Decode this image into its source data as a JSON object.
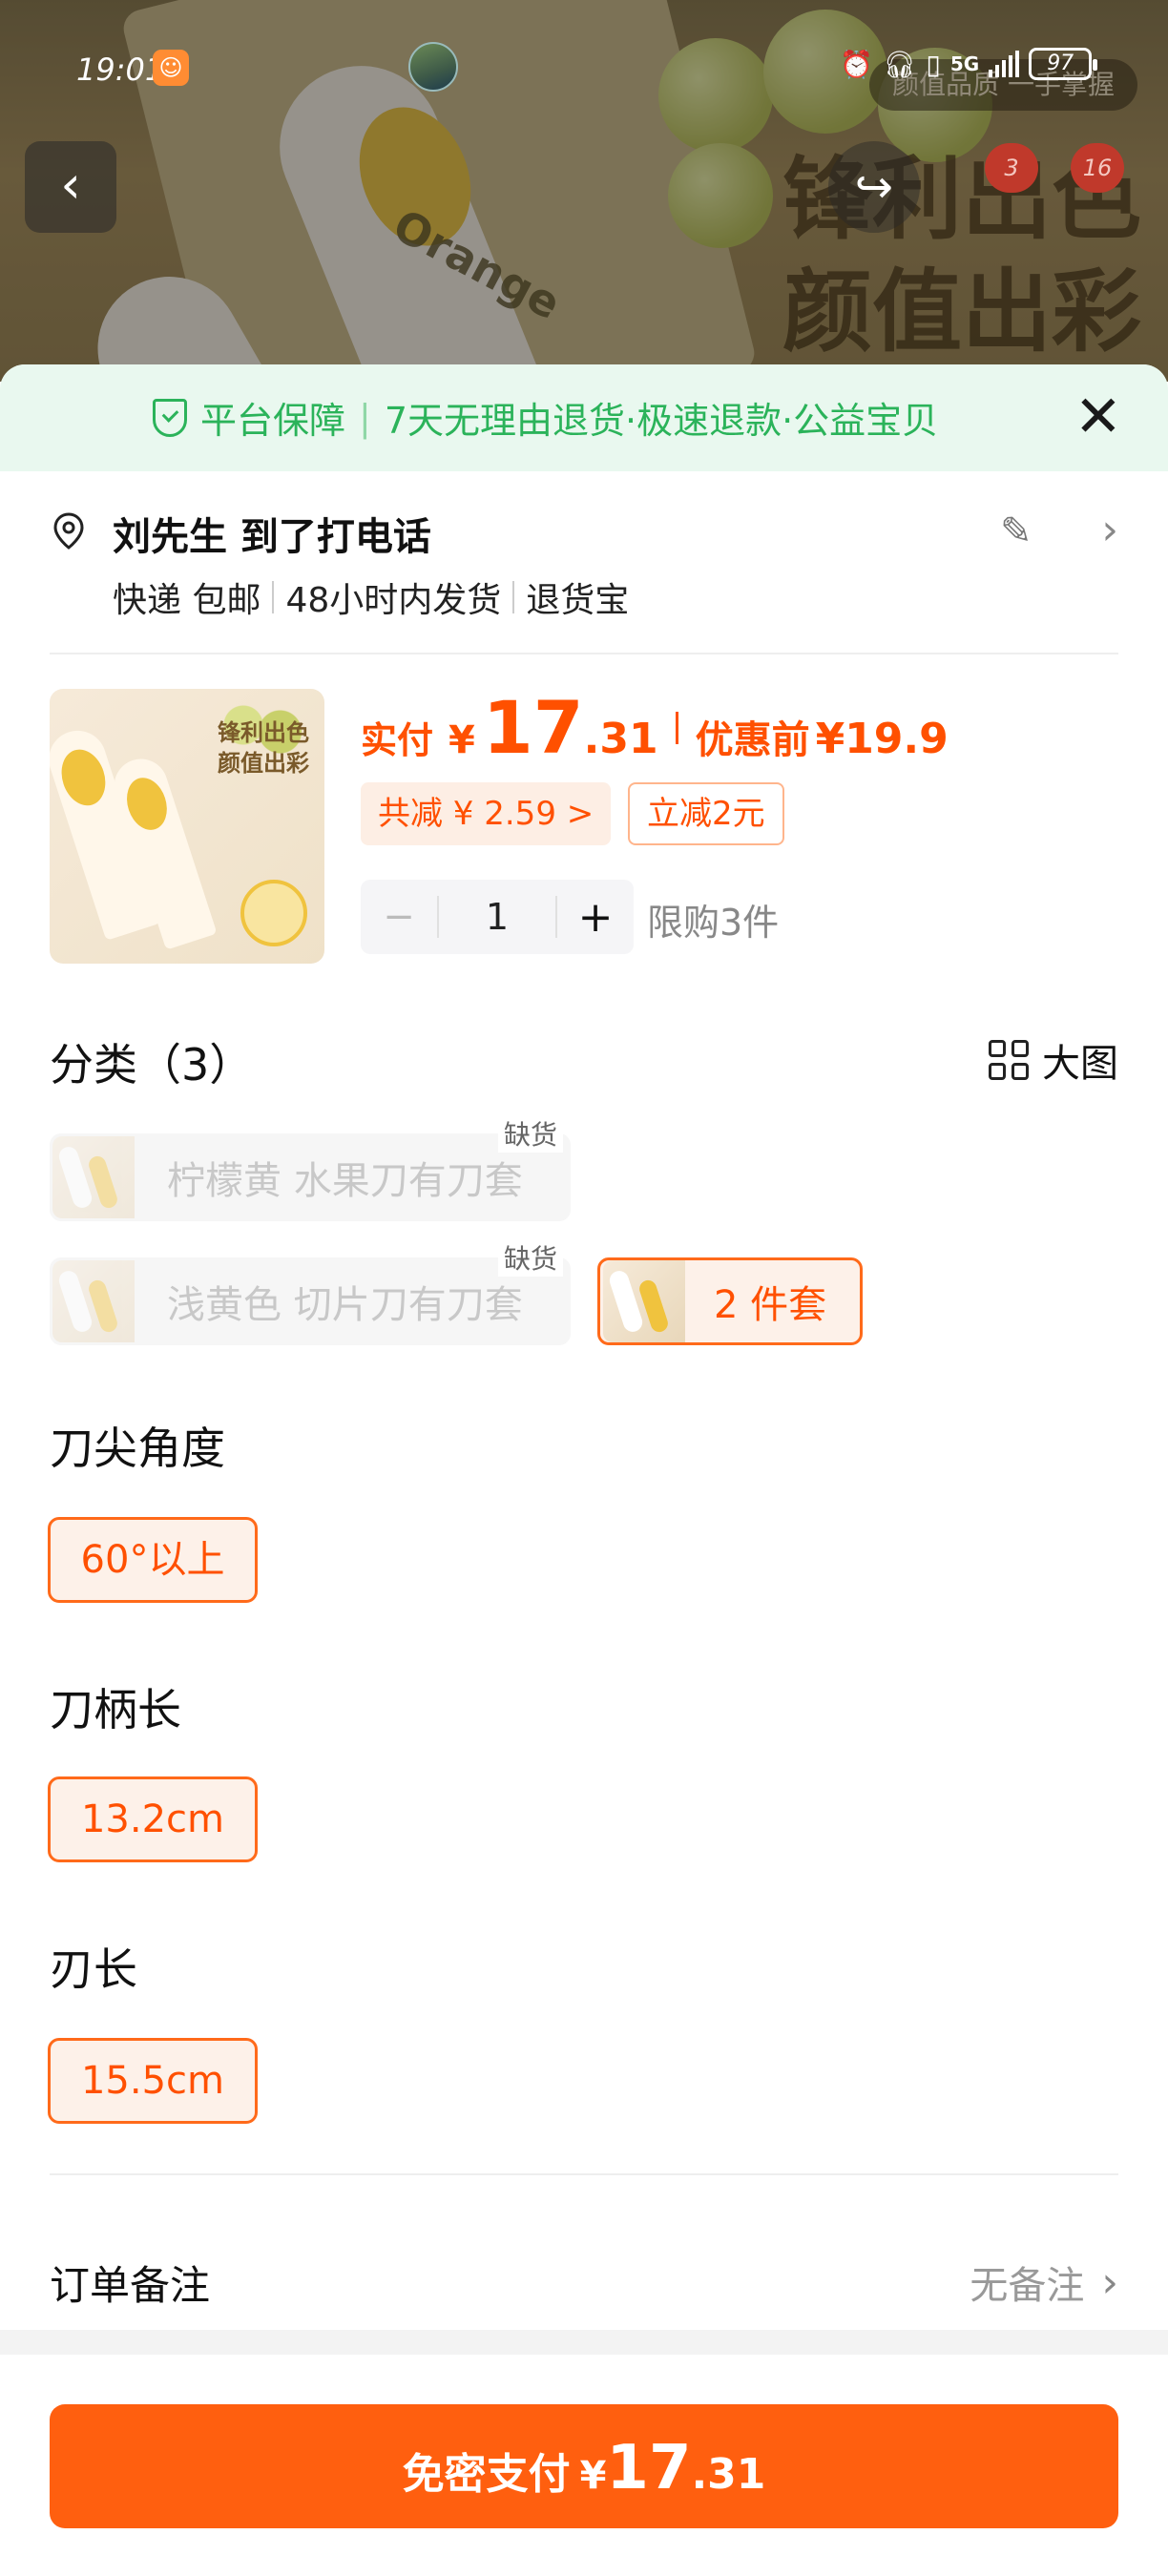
{
  "status_bar": {
    "time": "19:01",
    "network": "5G",
    "battery": "97"
  },
  "hero": {
    "brand_text": "Orange",
    "slogan_line1": "锋利出色",
    "slogan_line2": "颜值出彩",
    "chip_text": "颜值品质 一手掌握",
    "badge_1": "3",
    "badge_2": "16"
  },
  "guarantee": {
    "title": "平台保障",
    "items": "7天无理由退货·极速退款·公益宝贝"
  },
  "address": {
    "name_line": "刘先生 到了打电话",
    "delivery": "快递 包邮",
    "ship_time": "48小时内发货",
    "return": "退货宝"
  },
  "product": {
    "pay_label": "实付",
    "currency": "¥",
    "price_int": "17",
    "price_dec": ".31",
    "orig_label": "优惠前",
    "orig_price": "¥19.9",
    "total_discount": "共减 ¥ 2.59 >",
    "instant_discount": "立减2元",
    "quantity": "1",
    "limit": "限购3件",
    "image_slogan_1": "锋利出色",
    "image_slogan_2": "颜值出彩"
  },
  "category": {
    "title": "分类（3）",
    "big_view": "大图",
    "options": [
      {
        "label": "柠檬黄 水果刀有刀套",
        "status": "缺货"
      },
      {
        "label": "浅黄色 切片刀有刀套",
        "status": "缺货"
      },
      {
        "label": "2 件套",
        "status": ""
      }
    ]
  },
  "specs": [
    {
      "title": "刀尖角度",
      "value": "60°以上"
    },
    {
      "title": "刀柄长",
      "value": "13.2cm"
    },
    {
      "title": "刃长",
      "value": "15.5cm"
    }
  ],
  "order_note": {
    "label": "订单备注",
    "value": "无备注"
  },
  "pay_button": {
    "label": "免密支付",
    "currency": "¥",
    "price_int": "17",
    "price_dec": ".31"
  },
  "colors": {
    "accent": "#ff5000",
    "guarantee_green": "#2bb35a",
    "pay_button": "#ff5f0f"
  }
}
